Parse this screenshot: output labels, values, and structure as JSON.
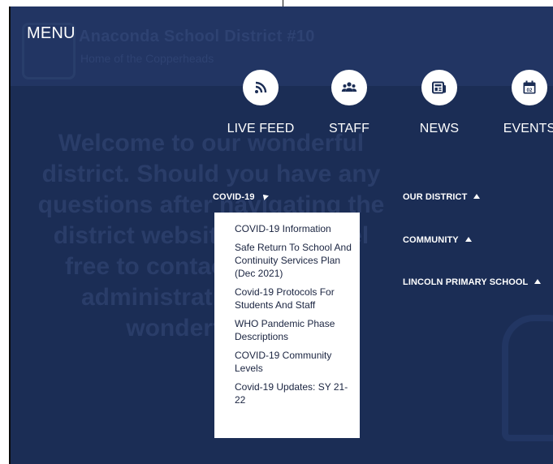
{
  "menu": {
    "label": "MENU"
  },
  "background": {
    "school_name": "Anaconda School District #10",
    "tagline": "Home of the Copperheads",
    "welcome": "Welcome to our wonderful district. Should you have any questions after navigating the district website, please feel free to contact any of our administration. Have a wonderful day."
  },
  "quick_links": [
    {
      "label": "LIVE FEED",
      "icon": "rss-icon"
    },
    {
      "label": "STAFF",
      "icon": "people-icon"
    },
    {
      "label": "NEWS",
      "icon": "newspaper-icon"
    },
    {
      "label": "EVENTS",
      "icon": "calendar-icon"
    }
  ],
  "nav": {
    "covid": "COVID-19",
    "our_district": "OUR DISTRICT",
    "community": "COMMUNITY",
    "lincoln": "LINCOLN PRIMARY SCHOOL"
  },
  "covid_menu": [
    "COVID-19 Information",
    "Safe Return To School And Continuity Services Plan (Dec 2021)",
    "Covid-19 Protocols For Students And Staff",
    "WHO Pandemic Phase Descriptions",
    "COVID-19 Community Levels",
    "Covid-19 Updates: SY 21-22"
  ],
  "colors": {
    "overlay": "#1b2d55",
    "text": "#ffffff",
    "dropdown_bg": "#ffffff"
  }
}
